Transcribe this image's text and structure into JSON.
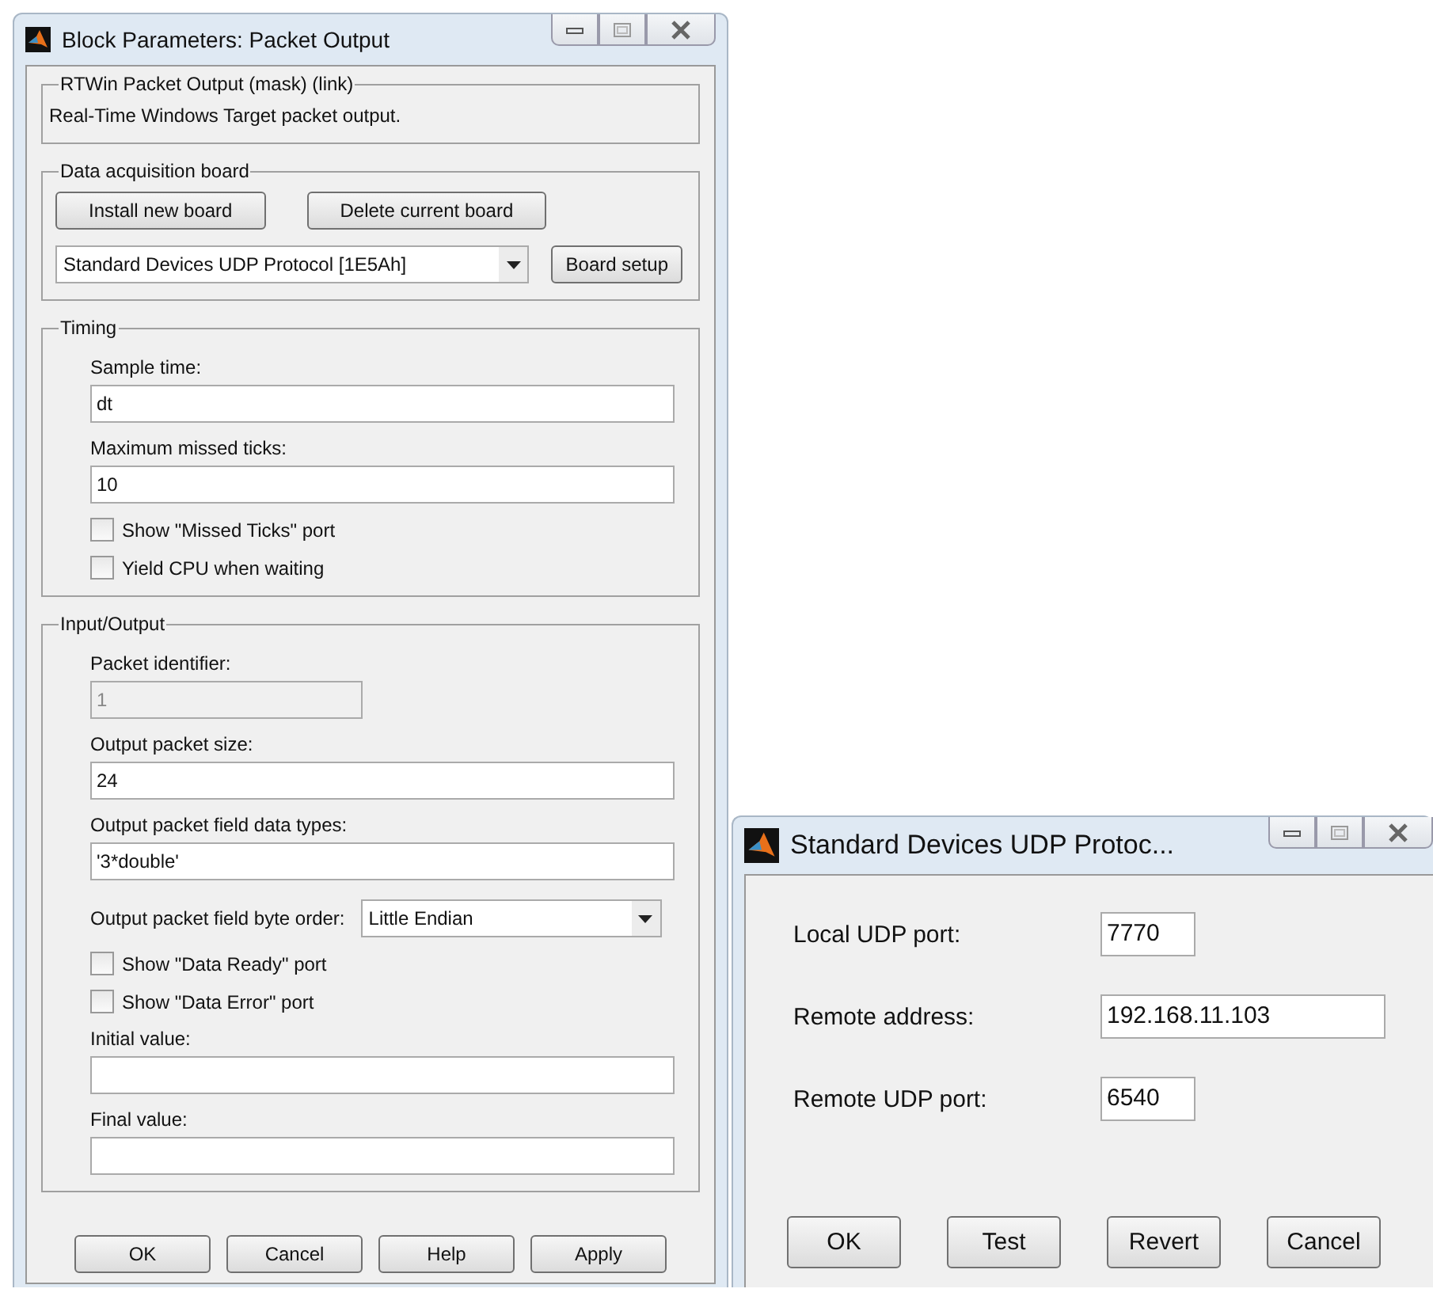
{
  "block_dialog": {
    "title": "Block Parameters: Packet Output",
    "sections": [
      {
        "title": "RTWin Packet Output (mask) (link)",
        "items": [
          {
            "kind": "text",
            "text": "Real-Time Windows Target packet output."
          }
        ]
      },
      {
        "title": "Data acquisition board",
        "items": [
          {
            "kind": "buttons",
            "buttons": [
              "Install new board",
              "Delete current board"
            ]
          },
          {
            "kind": "board-select",
            "value": "Standard Devices UDP Protocol [1E5Ah]",
            "button": "Board setup"
          }
        ]
      },
      {
        "title": "Timing",
        "items": [
          {
            "kind": "field",
            "label": "Sample time:",
            "value": "dt",
            "disabled": false
          },
          {
            "kind": "field",
            "label": "Maximum missed ticks:",
            "value": "10",
            "disabled": false
          },
          {
            "kind": "checkbox",
            "label": "Show \"Missed Ticks\" port",
            "checked": false
          },
          {
            "kind": "checkbox",
            "label": "Yield CPU when waiting",
            "checked": false
          }
        ]
      },
      {
        "title": "Input/Output",
        "items": [
          {
            "kind": "field",
            "label": "Packet identifier:",
            "value": "1",
            "disabled": true
          },
          {
            "kind": "field",
            "label": "Output packet size:",
            "value": "24",
            "disabled": false
          },
          {
            "kind": "field",
            "label": "Output packet field data types:",
            "value": "'3*double'",
            "disabled": false
          },
          {
            "kind": "select",
            "label": "Output packet field byte order:",
            "value": "Little Endian"
          },
          {
            "kind": "checkbox",
            "label": "Show \"Data Ready\" port",
            "checked": false
          },
          {
            "kind": "checkbox",
            "label": "Show \"Data Error\" port",
            "checked": false
          },
          {
            "kind": "field",
            "label": "Initial value:",
            "disabled": false
          },
          {
            "kind": "field",
            "label": "Final value:",
            "disabled": false
          }
        ]
      }
    ],
    "buttons": [
      "OK",
      "Cancel",
      "Help",
      "Apply"
    ]
  },
  "udp_dialog": {
    "title": "Standard Devices UDP Protoc...",
    "fields": [
      {
        "kind": "port",
        "label": "Local UDP port:",
        "value": "7770"
      },
      {
        "kind": "address",
        "label": "Remote address:",
        "value": "192.168.11.103"
      },
      {
        "kind": "port",
        "label": "Remote UDP port:",
        "value": "6540"
      }
    ],
    "buttons": [
      "OK",
      "Test",
      "Revert",
      "Cancel"
    ]
  }
}
